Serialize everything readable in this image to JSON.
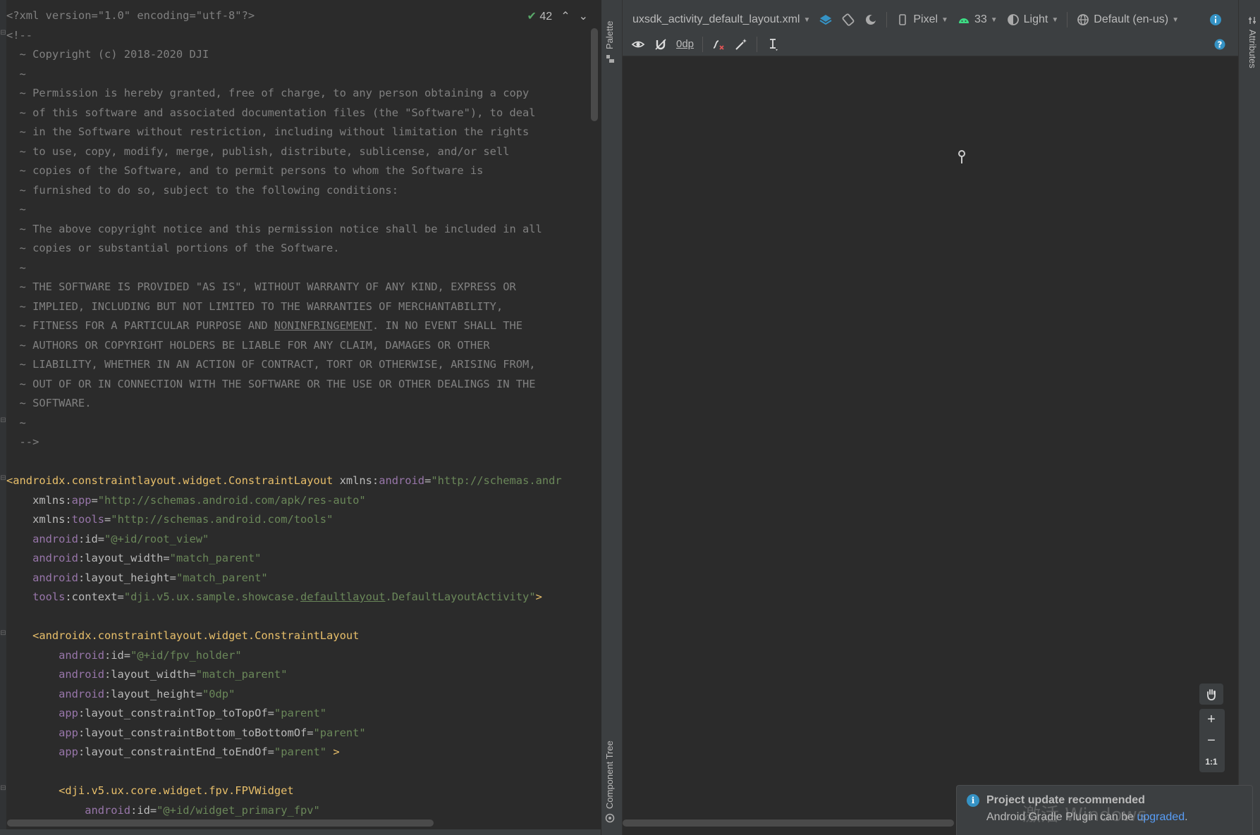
{
  "editor": {
    "inspection_count": "42",
    "lines": [
      [
        [
          "c",
          "<?xml version=\"1.0\" encoding=\"utf-8\"?>"
        ]
      ],
      [
        [
          "c",
          "<!--"
        ]
      ],
      [
        [
          "c",
          "  ~ Copyright (c) 2018-2020 DJI"
        ]
      ],
      [
        [
          "c",
          "  ~"
        ]
      ],
      [
        [
          "c",
          "  ~ Permission is hereby granted, free of charge, to any person obtaining a copy"
        ]
      ],
      [
        [
          "c",
          "  ~ of this software and associated documentation files (the \"Software\"), to deal"
        ]
      ],
      [
        [
          "c",
          "  ~ in the Software without restriction, including without limitation the rights"
        ]
      ],
      [
        [
          "c",
          "  ~ to use, copy, modify, merge, publish, distribute, sublicense, and/or sell"
        ]
      ],
      [
        [
          "c",
          "  ~ copies of the Software, and to permit persons to whom the Software is"
        ]
      ],
      [
        [
          "c",
          "  ~ furnished to do so, subject to the following conditions:"
        ]
      ],
      [
        [
          "c",
          "  ~"
        ]
      ],
      [
        [
          "c",
          "  ~ The above copyright notice and this permission notice shall be included in all"
        ]
      ],
      [
        [
          "c",
          "  ~ copies or substantial portions of the Software."
        ]
      ],
      [
        [
          "c",
          "  ~"
        ]
      ],
      [
        [
          "c",
          "  ~ THE SOFTWARE IS PROVIDED \"AS IS\", WITHOUT WARRANTY OF ANY KIND, EXPRESS OR"
        ]
      ],
      [
        [
          "c",
          "  ~ IMPLIED, INCLUDING BUT NOT LIMITED TO THE WARRANTIES OF MERCHANTABILITY,"
        ]
      ],
      [
        [
          "c",
          "  ~ FITNESS FOR A PARTICULAR PURPOSE AND "
        ],
        [
          "c uc",
          "NONINFRINGEMENT"
        ],
        [
          "c",
          ". IN NO EVENT SHALL THE"
        ]
      ],
      [
        [
          "c",
          "  ~ AUTHORS OR COPYRIGHT HOLDERS BE LIABLE FOR ANY CLAIM, DAMAGES OR OTHER"
        ]
      ],
      [
        [
          "c",
          "  ~ LIABILITY, WHETHER IN AN ACTION OF CONTRACT, TORT OR OTHERWISE, ARISING FROM,"
        ]
      ],
      [
        [
          "c",
          "  ~ OUT OF OR IN CONNECTION WITH THE SOFTWARE OR THE USE OR OTHER DEALINGS IN THE"
        ]
      ],
      [
        [
          "c",
          "  ~ SOFTWARE."
        ]
      ],
      [
        [
          "c",
          "  ~"
        ]
      ],
      [
        [
          "c",
          "  -->"
        ]
      ],
      [],
      [
        [
          "t",
          "<androidx.constraintlayout.widget.ConstraintLayout "
        ],
        [
          "an",
          "xmlns:"
        ],
        [
          "ns",
          "android"
        ],
        [
          "an",
          "="
        ],
        [
          "v",
          "\"http://schemas.andr"
        ]
      ],
      [
        [
          "an",
          "    xmlns:"
        ],
        [
          "ns",
          "app"
        ],
        [
          "an",
          "="
        ],
        [
          "v",
          "\"http://schemas.android.com/apk/res-auto\""
        ]
      ],
      [
        [
          "an",
          "    xmlns:"
        ],
        [
          "ns",
          "tools"
        ],
        [
          "an",
          "="
        ],
        [
          "v",
          "\"http://schemas.android.com/tools\""
        ]
      ],
      [
        [
          "ns",
          "    android"
        ],
        [
          "an",
          ":id="
        ],
        [
          "v",
          "\"@+id/root_view\""
        ]
      ],
      [
        [
          "ns",
          "    android"
        ],
        [
          "an",
          ":layout_width="
        ],
        [
          "v",
          "\"match_parent\""
        ]
      ],
      [
        [
          "ns",
          "    android"
        ],
        [
          "an",
          ":layout_height="
        ],
        [
          "v",
          "\"match_parent\""
        ]
      ],
      [
        [
          "ns",
          "    tools"
        ],
        [
          "an",
          ":context="
        ],
        [
          "v",
          "\"dji.v5.ux.sample.showcase."
        ],
        [
          "v u",
          "defaultlayout"
        ],
        [
          "v",
          ".DefaultLayoutActivity\""
        ],
        [
          "t",
          ">"
        ]
      ],
      [],
      [
        [
          "t",
          "    <androidx.constraintlayout.widget.ConstraintLayout"
        ]
      ],
      [
        [
          "ns",
          "        android"
        ],
        [
          "an",
          ":id="
        ],
        [
          "v",
          "\"@+id/fpv_holder\""
        ]
      ],
      [
        [
          "ns",
          "        android"
        ],
        [
          "an",
          ":layout_width="
        ],
        [
          "v",
          "\"match_parent\""
        ]
      ],
      [
        [
          "ns",
          "        android"
        ],
        [
          "an",
          ":layout_height="
        ],
        [
          "v",
          "\"0dp\""
        ]
      ],
      [
        [
          "ns",
          "        app"
        ],
        [
          "an",
          ":layout_constraintTop_toTopOf="
        ],
        [
          "v",
          "\"parent\""
        ]
      ],
      [
        [
          "ns",
          "        app"
        ],
        [
          "an",
          ":layout_constraintBottom_toBottomOf="
        ],
        [
          "v",
          "\"parent\""
        ]
      ],
      [
        [
          "ns",
          "        app"
        ],
        [
          "an",
          ":layout_constraintEnd_toEndOf="
        ],
        [
          "v",
          "\"parent\" "
        ],
        [
          "t",
          ">"
        ]
      ],
      [],
      [
        [
          "t",
          "        <dji.v5.ux.core.widget.fpv.FPVWidget"
        ]
      ],
      [
        [
          "ns",
          "            android"
        ],
        [
          "an",
          ":id="
        ],
        [
          "v",
          "\"@+id/widget_primary_fpv\""
        ]
      ]
    ]
  },
  "left_strip": {
    "palette_label": "Palette",
    "component_tree_label": "Component Tree"
  },
  "right_strip": {
    "attributes_label": "Attributes"
  },
  "designer": {
    "file_name": "uxsdk_activity_default_layout.xml",
    "device": "Pixel",
    "api_level": "33",
    "theme": "Light",
    "locale": "Default (en-us)",
    "margin_value": "0dp",
    "zoom": {
      "in": "+",
      "out": "−",
      "actual": "1:1"
    }
  },
  "notification": {
    "title": "Project update recommended",
    "body_prefix": "Android Gradle Plugin can be ",
    "link": "upgraded",
    "body_suffix": "."
  },
  "watermark": "激活 Windows",
  "colors": {
    "editor_bg": "#2b2b2b",
    "panel_bg": "#3c3f41",
    "comment": "#808080",
    "tag": "#e8bf6a",
    "namespace": "#9876aa",
    "value": "#6a8759",
    "accent": "#3592c4",
    "android_green": "#3ddc84"
  }
}
